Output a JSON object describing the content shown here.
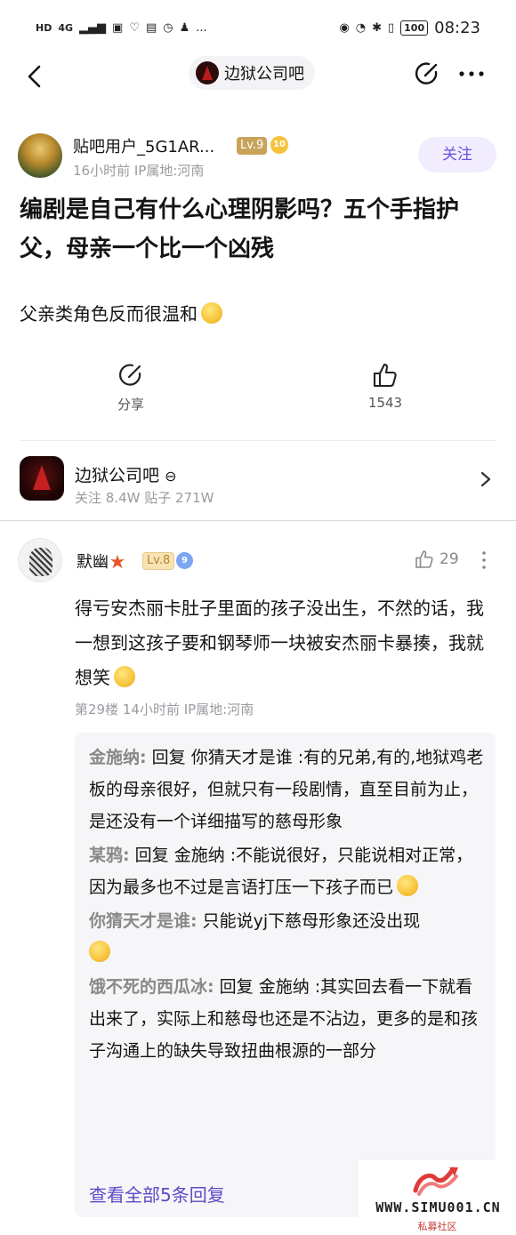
{
  "status_bar": {
    "left_tags": [
      "HD",
      "4G",
      "..."
    ],
    "battery": "100",
    "time": "08:23"
  },
  "nav": {
    "forum_title": "边狱公司吧"
  },
  "post": {
    "author": "贴吧用户_5G1AR...",
    "level": "Lv.9",
    "medal": "10",
    "meta": "16小时前   IP属地:河南",
    "follow_label": "关注",
    "title": "编剧是自己有什么心理阴影吗？五个手指护父，母亲一个比一个凶残",
    "body": "父亲类角色反而很温和",
    "share_label": "分享",
    "like_count": "1543"
  },
  "forum": {
    "name": "边狱公司吧",
    "stats": "关注 8.4W   贴子 271W"
  },
  "comment": {
    "author": "默幽",
    "level": "Lv.8",
    "medal": "9",
    "likes": "29",
    "text": "得亏安杰丽卡肚子里面的孩子没出生，不然的话，我一想到这孩子要和钢琴师一块被安杰丽卡暴揍，我就想笑",
    "meta": "第29楼   14小时前   IP属地:河南",
    "replies": [
      {
        "name": "金施纳:",
        "text": " 回复 你猜天才是谁 :有的兄弟,有的,地狱鸡老板的母亲很好，但就只有一段剧情，直至目前为止，是还没有一个详细描写的慈母形象"
      },
      {
        "name": "某鸦:",
        "text": " 回复 金施纳 :不能说很好，只能说相对正常，因为最多也不过是言语打压一下孩子而已"
      },
      {
        "name": "你猜天才是谁:",
        "text": " 只能说yj下慈母形象还没出现"
      },
      {
        "name": "饿不死的西瓜冰:",
        "text": " 回复 金施纳 :其实回去看一下就看出来了，实际上和慈母也还是不沾边，更多的是和孩子沟通上的缺失导致扭曲根源的一部分"
      }
    ],
    "see_all": "查看全部5条回复"
  },
  "watermark": {
    "text": "WWW.SIMU001.CN",
    "sub": "私募社区"
  },
  "colors": {
    "accent": "#6a51e0",
    "link": "#5d4ac7",
    "meta_gray": "#9a9aa0"
  }
}
